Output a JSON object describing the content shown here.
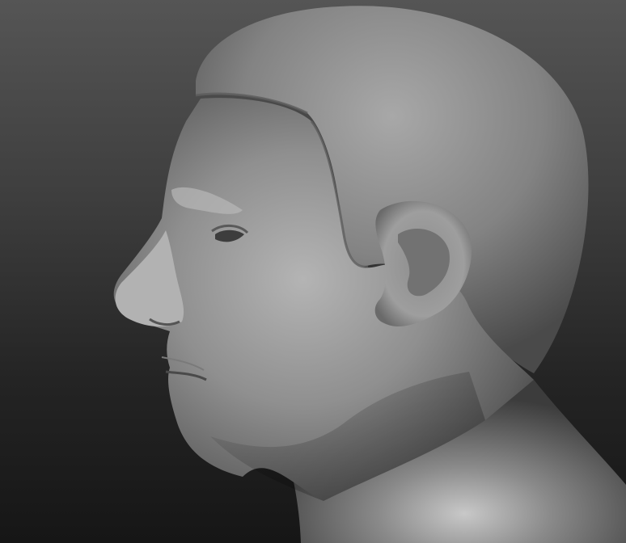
{
  "scene": {
    "subject": "",
    "background_color_top": "#555555",
    "background_color_bottom": "#161616",
    "sculpt_base_color": "#8a8a8a",
    "sculpt_highlight_color": "#c4c4c4",
    "sculpt_shadow_color": "#3a3a3a"
  }
}
